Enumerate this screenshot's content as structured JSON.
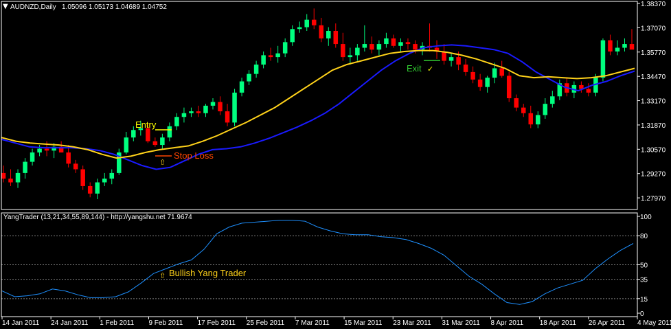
{
  "header": {
    "symbol_label": "AUDNZD,Daily",
    "ohlc": "1.05096 1.05173 1.04689 1.04752"
  },
  "indicator": {
    "label": "YangTrader (13,21,34,55,89,144) - http://yangshu.net 71.9674"
  },
  "annotations": {
    "entry": "Entry",
    "stop_loss": "Stop Loss",
    "exit": "Exit",
    "exit_check": "✓",
    "entry_arrow": "⇧",
    "bullish": "Bullish Yang Trader",
    "bullish_arrow": "⇧"
  },
  "colors": {
    "background": "#000000",
    "bull_candle": "#00ff7f",
    "bear_candle": "#ff0000",
    "fast_ma": "#1a1aff",
    "slow_ma": "#ffd21a",
    "oscillator": "#1e90ff",
    "entry_text": "#ffff00",
    "stop_text": "#ff4500",
    "exit_text": "#32cd32",
    "axis": "#ffffff",
    "grid": "#808080"
  },
  "chart_data": [
    {
      "type": "candlestick",
      "title": "AUDNZD,Daily",
      "ylim": [
        1.2779,
        1.3837
      ],
      "y_ticks": [
        "1.38370",
        "1.37070",
        "1.35770",
        "1.34470",
        "1.33170",
        "1.31870",
        "1.30570",
        "1.29270",
        "1.27970"
      ],
      "x_ticks": [
        "14 Jan 2011",
        "24 Jan 2011",
        "1 Feb 2011",
        "9 Feb 2011",
        "17 Feb 2011",
        "25 Feb 2011",
        "7 Mar 2011",
        "15 Mar 2011",
        "23 Mar 2011",
        "31 Mar 2011",
        "8 Apr 2011",
        "18 Apr 2011",
        "26 Apr 2011",
        "4 May 2011"
      ],
      "candles": [
        [
          1.293,
          1.297,
          1.288,
          1.29
        ],
        [
          1.29,
          1.295,
          1.286,
          1.288
        ],
        [
          1.288,
          1.295,
          1.285,
          1.293
        ],
        [
          1.293,
          1.301,
          1.29,
          1.299
        ],
        [
          1.299,
          1.306,
          1.297,
          1.304
        ],
        [
          1.304,
          1.308,
          1.302,
          1.306
        ],
        [
          1.306,
          1.31,
          1.302,
          1.305
        ],
        [
          1.305,
          1.309,
          1.301,
          1.307
        ],
        [
          1.307,
          1.31,
          1.304,
          1.304
        ],
        [
          1.304,
          1.308,
          1.296,
          1.298
        ],
        [
          1.298,
          1.3,
          1.293,
          1.295
        ],
        [
          1.295,
          1.297,
          1.284,
          1.286
        ],
        [
          1.286,
          1.288,
          1.28,
          1.282
        ],
        [
          1.282,
          1.29,
          1.279,
          1.288
        ],
        [
          1.288,
          1.293,
          1.286,
          1.29
        ],
        [
          1.29,
          1.295,
          1.287,
          1.293
        ],
        [
          1.293,
          1.306,
          1.292,
          1.304
        ],
        [
          1.304,
          1.315,
          1.303,
          1.312
        ],
        [
          1.312,
          1.318,
          1.31,
          1.316
        ],
        [
          1.316,
          1.321,
          1.313,
          1.317
        ],
        [
          1.317,
          1.319,
          1.309,
          1.31
        ],
        [
          1.31,
          1.312,
          1.307,
          1.308
        ],
        [
          1.308,
          1.314,
          1.306,
          1.312
        ],
        [
          1.312,
          1.32,
          1.31,
          1.318
        ],
        [
          1.318,
          1.325,
          1.316,
          1.323
        ],
        [
          1.323,
          1.328,
          1.32,
          1.325
        ],
        [
          1.325,
          1.328,
          1.323,
          1.326
        ],
        [
          1.326,
          1.329,
          1.323,
          1.325
        ],
        [
          1.325,
          1.33,
          1.323,
          1.329
        ],
        [
          1.329,
          1.333,
          1.327,
          1.331
        ],
        [
          1.331,
          1.334,
          1.324,
          1.326
        ],
        [
          1.326,
          1.33,
          1.318,
          1.32
        ],
        [
          1.32,
          1.338,
          1.318,
          1.336
        ],
        [
          1.336,
          1.344,
          1.334,
          1.342
        ],
        [
          1.342,
          1.348,
          1.34,
          1.346
        ],
        [
          1.346,
          1.353,
          1.344,
          1.351
        ],
        [
          1.351,
          1.358,
          1.349,
          1.356
        ],
        [
          1.356,
          1.36,
          1.353,
          1.355
        ],
        [
          1.355,
          1.361,
          1.352,
          1.357
        ],
        [
          1.357,
          1.365,
          1.355,
          1.363
        ],
        [
          1.363,
          1.372,
          1.361,
          1.37
        ],
        [
          1.37,
          1.374,
          1.368,
          1.371
        ],
        [
          1.371,
          1.378,
          1.369,
          1.375
        ],
        [
          1.375,
          1.381,
          1.37,
          1.372
        ],
        [
          1.372,
          1.376,
          1.363,
          1.365
        ],
        [
          1.365,
          1.371,
          1.361,
          1.369
        ],
        [
          1.369,
          1.373,
          1.36,
          1.362
        ],
        [
          1.362,
          1.368,
          1.353,
          1.355
        ],
        [
          1.355,
          1.36,
          1.351,
          1.356
        ],
        [
          1.356,
          1.362,
          1.353,
          1.36
        ],
        [
          1.36,
          1.372,
          1.358,
          1.362
        ],
        [
          1.362,
          1.366,
          1.357,
          1.359
        ],
        [
          1.359,
          1.364,
          1.356,
          1.362
        ],
        [
          1.362,
          1.368,
          1.36,
          1.365
        ],
        [
          1.365,
          1.367,
          1.36,
          1.361
        ],
        [
          1.361,
          1.365,
          1.358,
          1.363
        ],
        [
          1.363,
          1.365,
          1.359,
          1.362
        ],
        [
          1.362,
          1.364,
          1.357,
          1.359
        ],
        [
          1.359,
          1.363,
          1.356,
          1.361
        ],
        [
          1.361,
          1.373,
          1.358,
          1.36
        ],
        [
          1.36,
          1.364,
          1.354,
          1.358
        ],
        [
          1.358,
          1.362,
          1.351,
          1.353
        ],
        [
          1.353,
          1.357,
          1.35,
          1.355
        ],
        [
          1.355,
          1.358,
          1.348,
          1.351
        ],
        [
          1.351,
          1.354,
          1.345,
          1.347
        ],
        [
          1.347,
          1.35,
          1.341,
          1.343
        ],
        [
          1.343,
          1.346,
          1.337,
          1.339
        ],
        [
          1.339,
          1.345,
          1.336,
          1.344
        ],
        [
          1.344,
          1.352,
          1.341,
          1.349
        ],
        [
          1.349,
          1.353,
          1.344,
          1.345
        ],
        [
          1.345,
          1.347,
          1.331,
          1.333
        ],
        [
          1.333,
          1.335,
          1.326,
          1.328
        ],
        [
          1.328,
          1.33,
          1.323,
          1.325
        ],
        [
          1.325,
          1.329,
          1.317,
          1.319
        ],
        [
          1.319,
          1.326,
          1.317,
          1.324
        ],
        [
          1.324,
          1.333,
          1.322,
          1.33
        ],
        [
          1.33,
          1.337,
          1.328,
          1.334
        ],
        [
          1.334,
          1.343,
          1.332,
          1.341
        ],
        [
          1.341,
          1.344,
          1.334,
          1.336
        ],
        [
          1.336,
          1.342,
          1.333,
          1.34
        ],
        [
          1.34,
          1.342,
          1.336,
          1.338
        ],
        [
          1.338,
          1.341,
          1.334,
          1.336
        ],
        [
          1.336,
          1.346,
          1.334,
          1.344
        ],
        [
          1.344,
          1.365,
          1.342,
          1.364
        ],
        [
          1.364,
          1.367,
          1.356,
          1.358
        ],
        [
          1.358,
          1.364,
          1.356,
          1.36
        ],
        [
          1.36,
          1.365,
          1.358,
          1.362
        ],
        [
          1.362,
          1.37,
          1.36,
          1.359
        ]
      ],
      "series": [
        {
          "values": [
            1.311,
            1.309,
            1.307,
            1.3065,
            1.3065,
            1.3065,
            1.306,
            1.305,
            1.303,
            1.3,
            1.297,
            1.295,
            1.296,
            1.2995,
            1.303,
            1.3055,
            1.306,
            1.307,
            1.309,
            1.3115,
            1.3145,
            1.3175,
            1.321,
            1.325,
            1.33,
            1.336,
            1.342,
            1.348,
            1.353,
            1.357,
            1.36,
            1.361,
            1.3615,
            1.361,
            1.36,
            1.359,
            1.357,
            1.3525,
            1.347,
            1.343,
            1.339,
            1.337,
            1.34,
            1.342,
            1.345,
            1.3475
          ]
        },
        {
          "values": [
            1.312,
            1.31,
            1.309,
            1.3085,
            1.308,
            1.307,
            1.3055,
            1.303,
            1.301,
            1.302,
            1.304,
            1.3055,
            1.3065,
            1.3075,
            1.31,
            1.313,
            1.3165,
            1.32,
            1.324,
            1.328,
            1.333,
            1.338,
            1.343,
            1.348,
            1.351,
            1.353,
            1.355,
            1.357,
            1.358,
            1.3585,
            1.3585,
            1.3575,
            1.356,
            1.354,
            1.3515,
            1.349,
            1.345,
            1.344,
            1.3445,
            1.344,
            1.3435,
            1.344,
            1.345,
            1.347,
            1.349
          ]
        }
      ]
    },
    {
      "type": "line",
      "title": "YangTrader (13,21,34,55,89,144)",
      "ylim": [
        0,
        100
      ],
      "y_ticks": [
        "100",
        "80",
        "50",
        "35",
        "15",
        "0"
      ],
      "levels": [
        80,
        50,
        35,
        15
      ],
      "series": [
        {
          "values": [
            23,
            17,
            18,
            20,
            25,
            23,
            19,
            16,
            16,
            17,
            22,
            31,
            41,
            46,
            51,
            55,
            66,
            82,
            89,
            93,
            94,
            95,
            96,
            96,
            95,
            89,
            85,
            82,
            81,
            81,
            79,
            78,
            76,
            72,
            67,
            60,
            49,
            38,
            30,
            20,
            11,
            9,
            12,
            20,
            26,
            30,
            34,
            46,
            56,
            65,
            72
          ]
        }
      ]
    }
  ]
}
